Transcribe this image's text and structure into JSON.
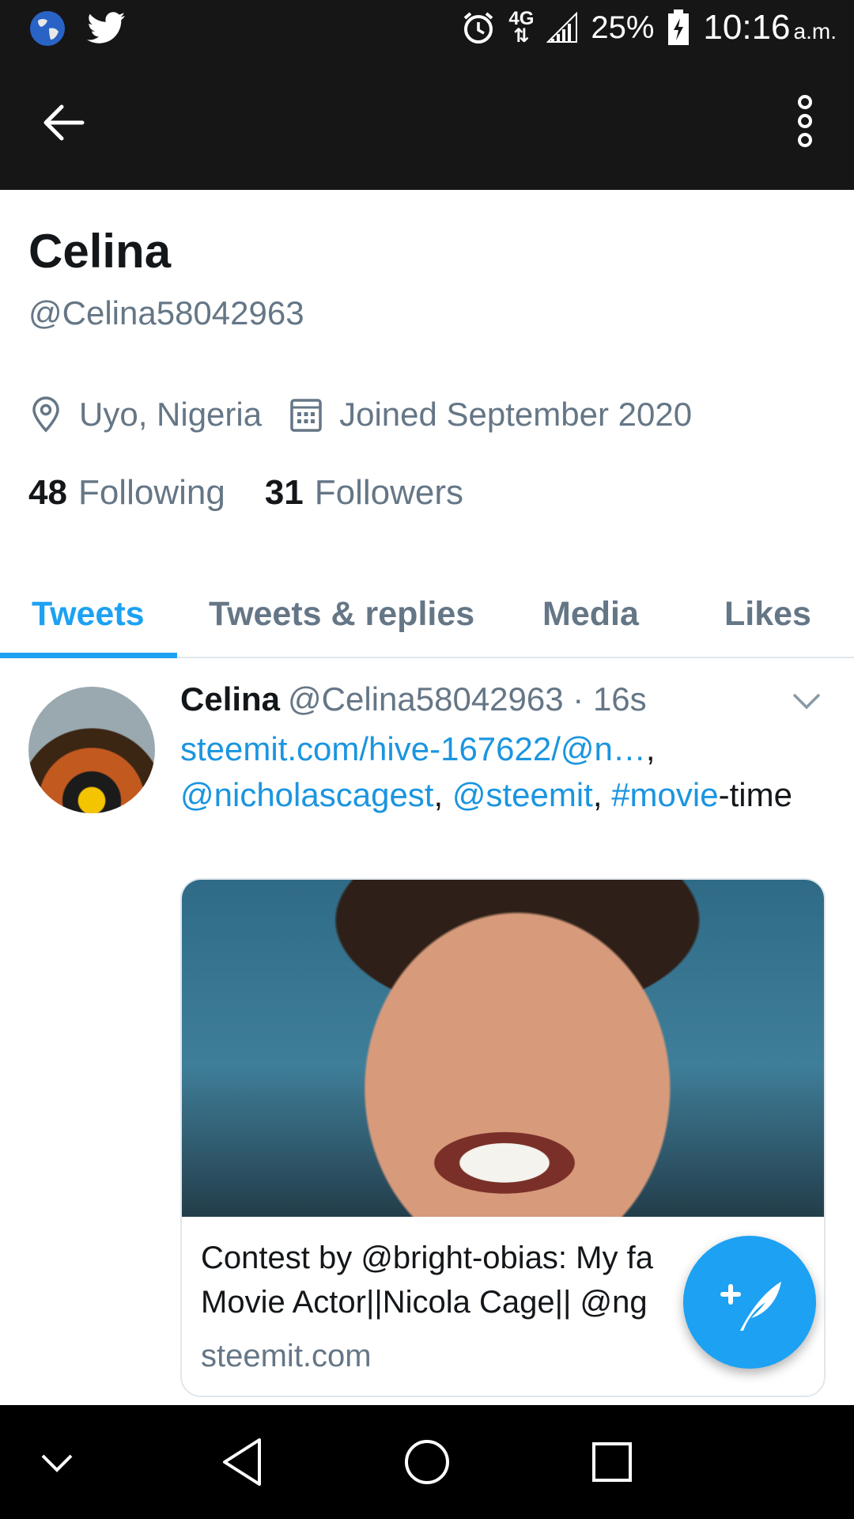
{
  "status_bar": {
    "signal_label": "4G",
    "battery": "25%",
    "time": "10:16",
    "ampm": "a.m.",
    "left_icons": [
      "globe-icon",
      "twitter-bird-icon"
    ],
    "right_icons": [
      "alarm-icon",
      "network-4g-icon",
      "signal-bars-icon",
      "battery-charging-icon"
    ]
  },
  "toolbar": {
    "back_icon": "arrow-left-icon",
    "more_icon": "more-vertical-icon"
  },
  "profile": {
    "name": "Celina",
    "handle": "@Celina58042963",
    "location": "Uyo, Nigeria",
    "joined": "Joined September 2020",
    "following_count": "48",
    "following_label": "Following",
    "followers_count": "31",
    "followers_label": "Followers"
  },
  "tabs": [
    {
      "label": "Tweets",
      "active": true
    },
    {
      "label": "Tweets & replies",
      "active": false
    },
    {
      "label": "Media",
      "active": false
    },
    {
      "label": "Likes",
      "active": false
    }
  ],
  "tweet": {
    "name": "Celina",
    "handle_time": "@Celina58042963 · 16s",
    "link_text": "steemit.com/hive-167622/@n…",
    "comma1": ",",
    "mention1": "@nicholascagest",
    "comma2": ", ",
    "mention2": "@steemit",
    "comma3": ", ",
    "hashtag": "#movie",
    "rest": "-time",
    "card": {
      "title_line1": "Contest by @bright-obias: My fa",
      "title_line2": "Movie Actor||Nicola Cage|| @ng",
      "domain": "steemit.com"
    }
  },
  "colors": {
    "accent": "#1da1f2",
    "link": "#1b95e0",
    "secondary_text": "#657786",
    "bar_background": "#161616"
  }
}
